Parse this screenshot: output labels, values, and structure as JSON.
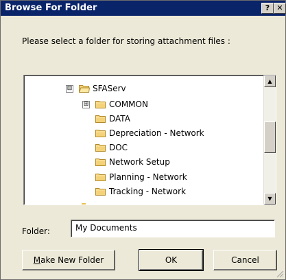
{
  "window": {
    "title": "Browse For Folder",
    "help_label": "?",
    "close_label": "✕"
  },
  "prompt": "Please select a folder for storing attachment files :",
  "tree": {
    "root": {
      "label": "SFAServ",
      "expander": "⊟"
    },
    "items": [
      {
        "label": "COMMON",
        "expander": "⊞"
      },
      {
        "label": "DATA"
      },
      {
        "label": "Depreciation - Network"
      },
      {
        "label": "DOC"
      },
      {
        "label": "Network Setup"
      },
      {
        "label": "Planning - Network"
      },
      {
        "label": "Tracking - Network"
      }
    ],
    "scroll_up": "▲",
    "scroll_down": "▼"
  },
  "folder": {
    "label": "Folder:",
    "value": "My Documents"
  },
  "buttons": {
    "make_new_prefix": "M",
    "make_new_rest": "ake New Folder",
    "ok": "OK",
    "cancel": "Cancel"
  },
  "colors": {
    "title_bar": "#0a246a",
    "face": "#ece9d8",
    "folder_yellow": "#f4d27a"
  }
}
